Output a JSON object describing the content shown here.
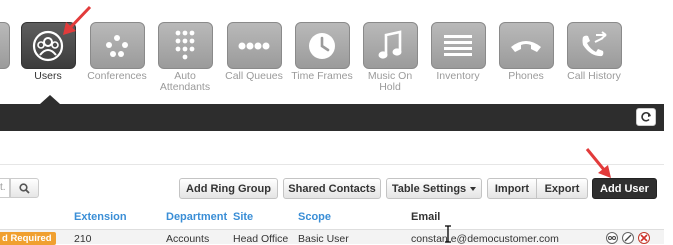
{
  "nav": {
    "items": [
      {
        "label": "Users",
        "icon": "users-icon",
        "active": true
      },
      {
        "label": "Conferences",
        "icon": "conferences-icon",
        "active": false
      },
      {
        "label": "Auto Attendants",
        "icon": "keypad-icon",
        "active": false
      },
      {
        "label": "Call Queues",
        "icon": "queue-dots-icon",
        "active": false
      },
      {
        "label": "Time Frames",
        "icon": "clock-icon",
        "active": false
      },
      {
        "label": "Music On Hold",
        "icon": "music-note-icon",
        "active": false
      },
      {
        "label": "Inventory",
        "icon": "list-lines-icon",
        "active": false
      },
      {
        "label": "Phones",
        "icon": "phone-handset-icon",
        "active": false
      },
      {
        "label": "Call History",
        "icon": "call-history-icon",
        "active": false
      }
    ]
  },
  "search": {
    "placeholder": "t."
  },
  "toolbar": {
    "add_ring_group": "Add Ring Group",
    "shared_contacts": "Shared Contacts",
    "table_settings": "Table Settings",
    "import": "Import",
    "export": "Export",
    "add_user": "Add User"
  },
  "table": {
    "headers": {
      "extension": "Extension",
      "department": "Department",
      "site": "Site",
      "scope": "Scope",
      "email": "Email"
    },
    "rows": [
      {
        "status": "d Required",
        "extension": "210",
        "department": "Accounts",
        "site": "Head Office",
        "scope": "Basic User",
        "email": "constan e@democustomer.com"
      }
    ]
  },
  "colors": {
    "accent_link": "#3a8ed6",
    "primary_button": "#2f2f2f",
    "badge": "#f0a030",
    "arrow": "#e23b3b"
  }
}
